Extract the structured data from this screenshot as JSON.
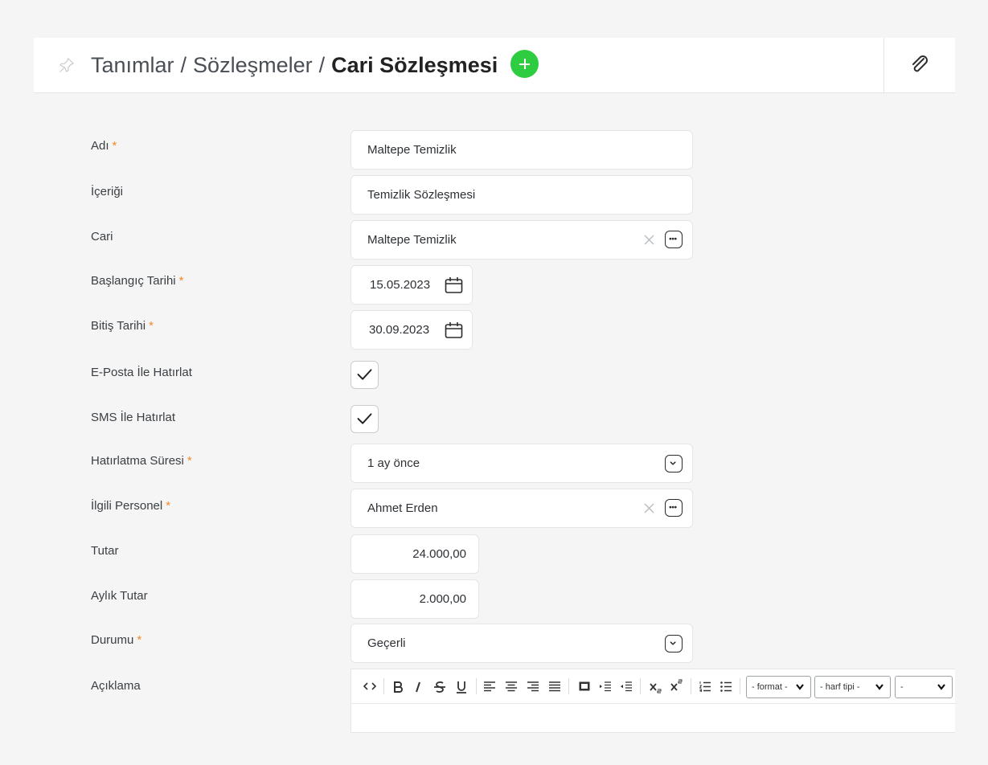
{
  "header": {
    "breadcrumb": [
      "Tanımlar",
      "Sözleşmeler"
    ],
    "separator": "/",
    "current": "Cari Sözleşmesi"
  },
  "required_mark": "*",
  "form": {
    "adi": {
      "label": "Adı",
      "value": "Maltepe Temizlik",
      "required": true
    },
    "icerigi": {
      "label": "İçeriği",
      "value": "Temizlik Sözleşmesi"
    },
    "cari": {
      "label": "Cari",
      "value": "Maltepe Temizlik"
    },
    "baslangic": {
      "label": "Başlangıç Tarihi",
      "value": "15.05.2023",
      "required": true
    },
    "bitis": {
      "label": "Bitiş Tarihi",
      "value": "30.09.2023",
      "required": true
    },
    "eposta": {
      "label": "E-Posta İle Hatırlat",
      "checked": true
    },
    "sms": {
      "label": "SMS İle Hatırlat",
      "checked": true
    },
    "hatirlatma": {
      "label": "Hatırlatma Süresi",
      "value": "1 ay önce",
      "required": true
    },
    "personel": {
      "label": "İlgili Personel",
      "value": "Ahmet Erden",
      "required": true
    },
    "tutar": {
      "label": "Tutar",
      "value": "24.000,00"
    },
    "aylik": {
      "label": "Aylık Tutar",
      "value": "2.000,00"
    },
    "durumu": {
      "label": "Durumu",
      "value": "Geçerli",
      "required": true
    },
    "aciklama": {
      "label": "Açıklama"
    }
  },
  "editor": {
    "format_select": "- format -",
    "font_select": "- harf tipi -",
    "size_select": "-"
  },
  "colors": {
    "accent_green": "#2ecc40",
    "required_orange": "#f08a2c"
  }
}
